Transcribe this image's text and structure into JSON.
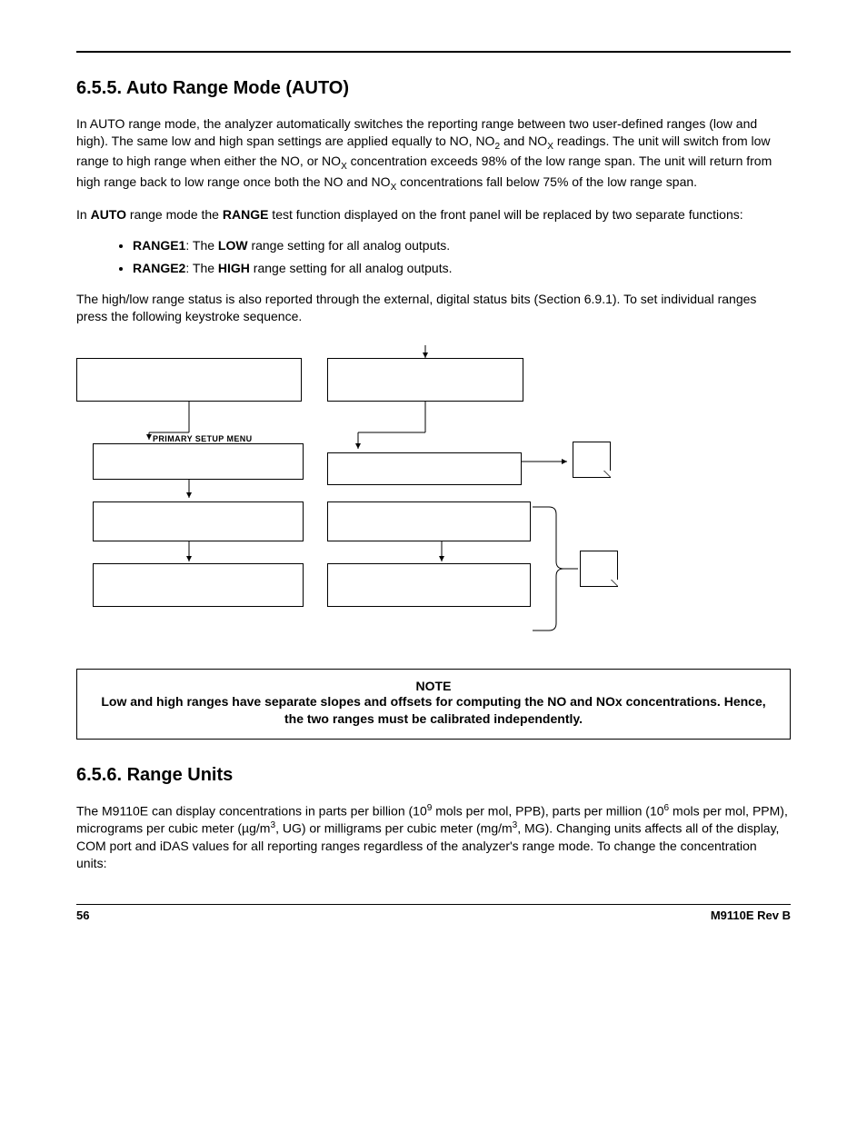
{
  "section655": {
    "heading": "6.5.5. Auto Range Mode (AUTO)",
    "p1_a": "In AUTO range mode, the analyzer automatically switches the reporting range between two user-defined ranges (low and high). The same low and high span settings are applied equally to NO, NO",
    "p1_sub1": "2",
    "p1_b": " and NO",
    "p1_sub2": "X",
    "p1_c": " readings. The unit will switch from low range to high range when either the NO, or NO",
    "p1_sub3": "X",
    "p1_d": " concentration exceeds 98% of the low range span. The unit will return from high range back to low range once both the NO and NO",
    "p1_sub4": "X",
    "p1_e": " concentrations fall below 75% of the low range span.",
    "p2_a": "In ",
    "p2_b": "AUTO",
    "p2_c": " range mode the ",
    "p2_d": "RANGE",
    "p2_e": " test function displayed on the front panel will be replaced by two separate functions:",
    "li1_a": "RANGE1",
    "li1_b": ": The ",
    "li1_c": "LOW",
    "li1_d": " range setting for all analog outputs.",
    "li2_a": "RANGE2",
    "li2_b": ": The ",
    "li2_c": "HIGH",
    "li2_d": " range setting for all analog outputs.",
    "p3": "The high/low range status is also reported through the external, digital status bits (Section 6.9.1). To set individual ranges press the following keystroke sequence."
  },
  "flow": {
    "label_primary": "PRIMARY SETUP MENU"
  },
  "note": {
    "title": "NOTE",
    "text": "Low and high ranges have separate slopes and offsets for computing the NO and NOx concentrations. Hence, the two ranges must be calibrated independently."
  },
  "section656": {
    "heading": "6.5.6. Range Units",
    "p1_a": "The M9110E can display concentrations in parts per billion (10",
    "p1_sup1": "9",
    "p1_b": " mols per mol, PPB), parts per million (10",
    "p1_sup2": "6",
    "p1_c": " mols per mol, PPM), micrograms per cubic meter (µg/m",
    "p1_sup3": "3",
    "p1_d": ", UG) or milligrams per cubic meter (mg/m",
    "p1_sup4": "3",
    "p1_e": ", MG). Changing units affects all of the display, COM port and iDAS values for all reporting ranges regardless of the analyzer's range mode. To change the concentration units:"
  },
  "footer": {
    "page": "56",
    "doc": "M9110E Rev B"
  }
}
